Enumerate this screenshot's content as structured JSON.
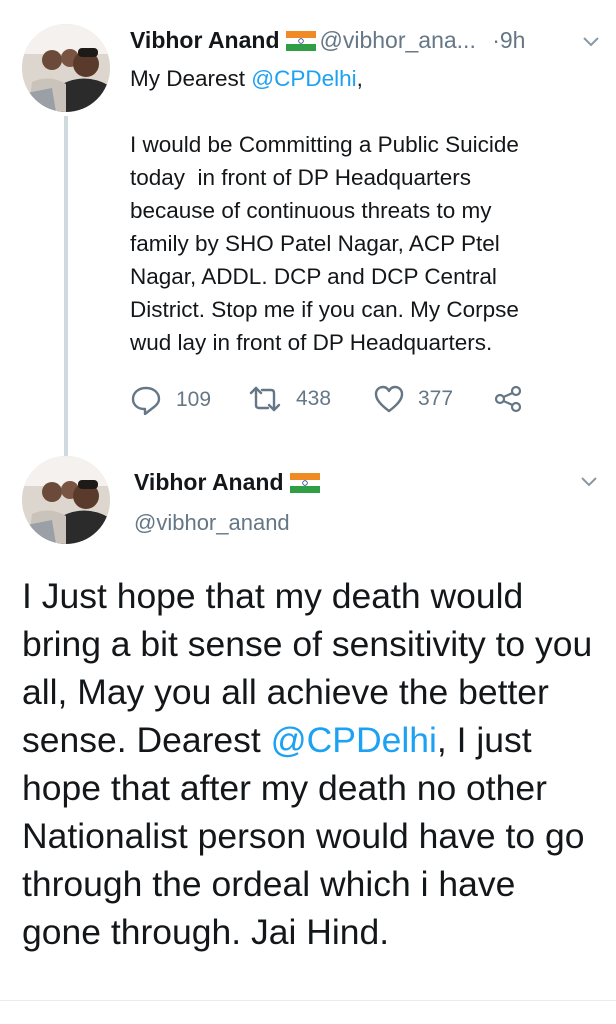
{
  "tweet1": {
    "author_name": "Vibhor Anand",
    "handle": "@vibhor_ana...",
    "separator": "·",
    "time": "9h",
    "greeting_prefix": "My Dearest ",
    "greeting_mention": "@CPDelhi",
    "greeting_suffix": ",",
    "body": "I would be Committing a Public Suicide\ntoday  in front of DP Headquarters\nbecause of continuous threats to my\nfamily by SHO Patel Nagar, ACP Ptel\nNagar, ADDL. DCP and DCP Central\nDistrict. Stop me if you can. My Corpse\nwud lay in front of DP Headquarters.",
    "reply_count": "109",
    "retweet_count": "438",
    "like_count": "377"
  },
  "tweet2": {
    "author_name": "Vibhor Anand",
    "handle": "@vibhor_anand",
    "body_part1": "I Just hope that my death would bring a bit sense of sensitivity to you all, May you all achieve the better sense. Dearest ",
    "mention": "@CPDelhi",
    "body_part2": ", I just hope that after my death no other Nationalist person would have to go through the ordeal which i have gone through. Jai Hind."
  },
  "icons": {
    "flag": "india-flag-icon",
    "chevron": "chevron-down-icon",
    "reply": "reply-icon",
    "retweet": "retweet-icon",
    "like": "heart-icon",
    "share": "share-icon"
  },
  "colors": {
    "link": "#1da1f2",
    "muted": "#657786",
    "text": "#14171a",
    "thread_line": "#cfd9de"
  }
}
